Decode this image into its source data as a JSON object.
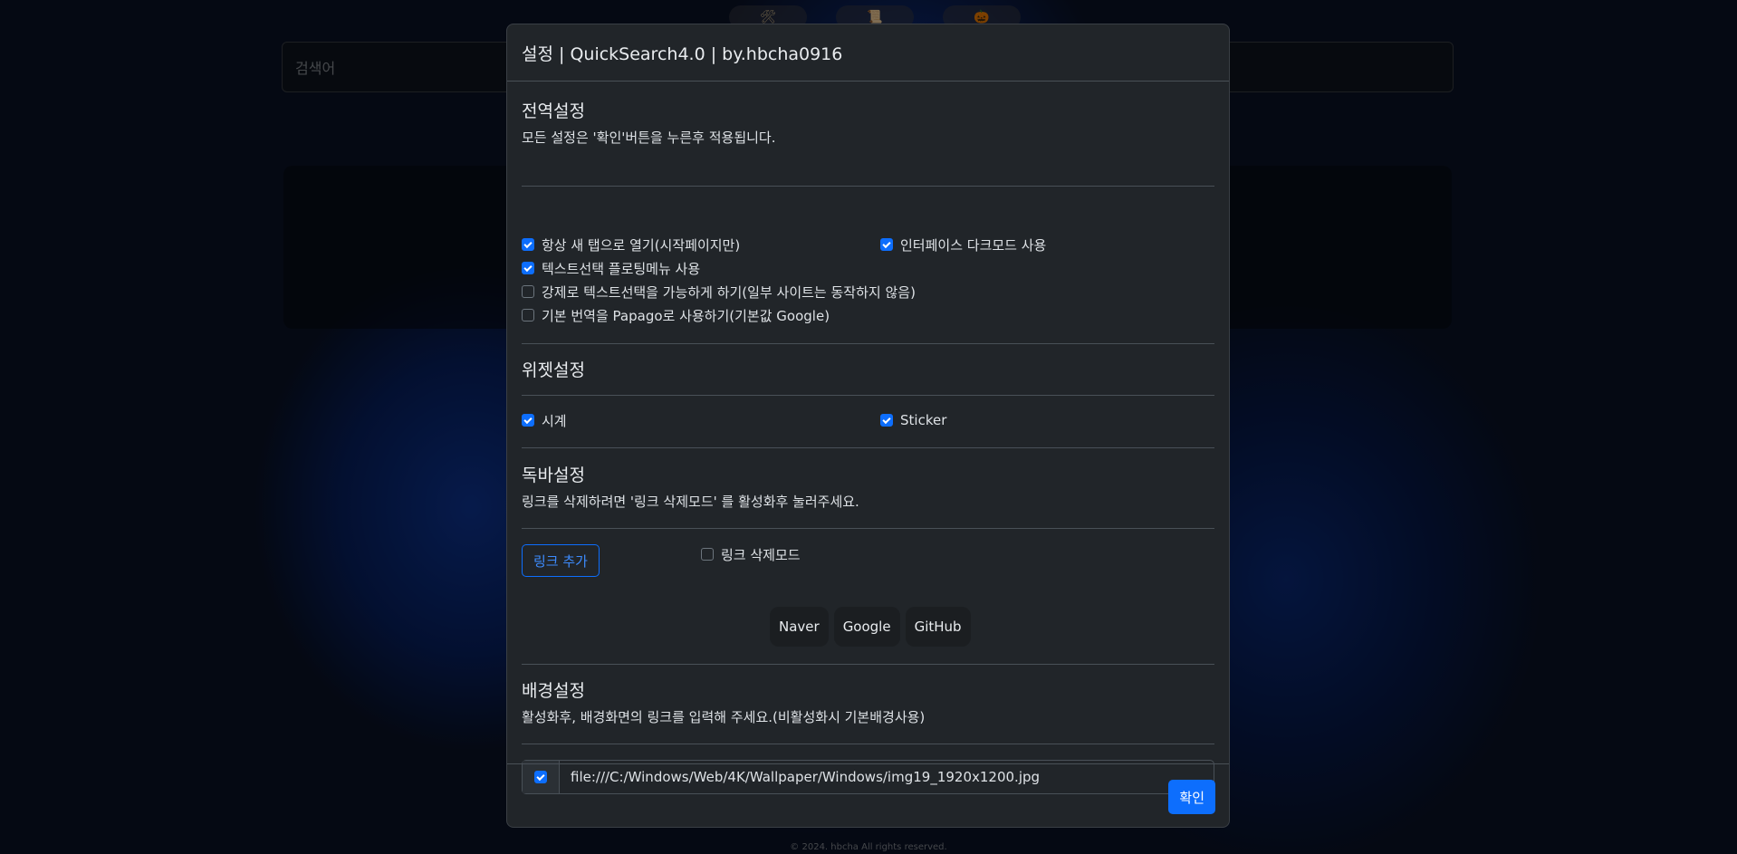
{
  "top_icons": [
    "🛠",
    "📜",
    "🎃"
  ],
  "search": {
    "placeholder": "검색어"
  },
  "footer": {
    "text": "© 2024. hbcha All rights reserved."
  },
  "modal": {
    "title": "설정 | QuickSearch4.0 | by.hbcha0916",
    "global": {
      "title": "전역설정",
      "desc": "모든 설정은 '확인'버튼을 누른후 적용됩니다.",
      "options": [
        {
          "label": "항상 새 탭으로 열기(시작페이지만)",
          "checked": true
        },
        {
          "label": "인터페이스 다크모드 사용",
          "checked": true
        },
        {
          "label": "텍스트선택 플로팅메뉴 사용",
          "checked": true
        },
        {
          "label": "강제로 텍스트선택을 가능하게 하기(일부 사이트는 동작하지 않음)",
          "checked": false
        },
        {
          "label": "기본 번역을 Papago로 사용하기(기본값 Google)",
          "checked": false
        }
      ]
    },
    "widget": {
      "title": "위젯설정",
      "options": [
        {
          "label": "시계",
          "checked": true
        },
        {
          "label": "Sticker",
          "checked": true
        }
      ]
    },
    "dock": {
      "title": "독바설정",
      "desc": "링크를 삭제하려면 '링크 삭제모드' 를 활성화후 눌러주세요.",
      "add_link_label": "링크 추가",
      "delete_mode_label": "링크 삭제모드",
      "delete_mode_checked": false,
      "links": [
        "Naver",
        "Google",
        "GitHub"
      ]
    },
    "background": {
      "title": "배경설정",
      "desc": "활성화후, 배경화면의 링크를 입력해 주세요.(비활성화시 기본배경사용)",
      "enabled": true,
      "url": "file:///C:/Windows/Web/4K/Wallpaper/Windows/img19_1920x1200.jpg"
    },
    "confirm_label": "확인"
  },
  "colors": {
    "accent": "#0d6efd",
    "modal_bg": "#212529"
  }
}
